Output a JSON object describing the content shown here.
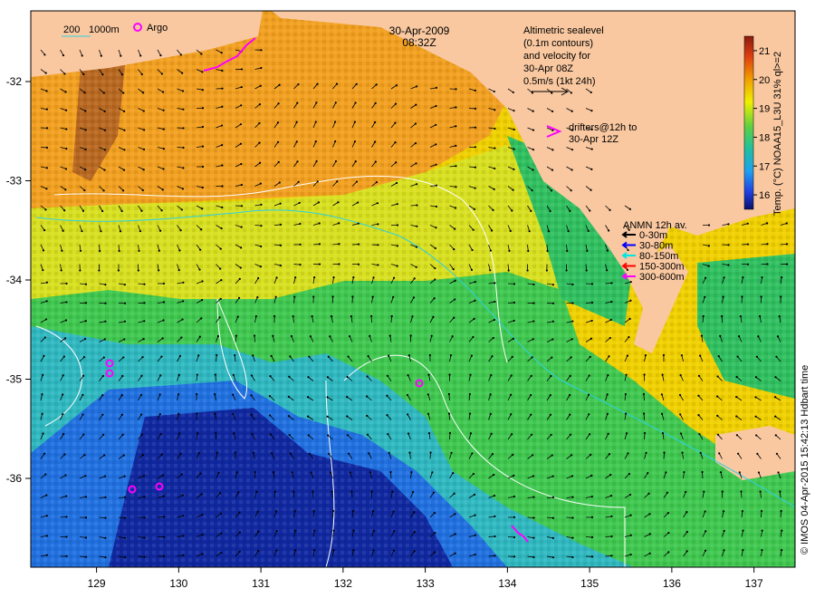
{
  "header": {
    "date": "30-Apr-2009",
    "time": "08:32Z"
  },
  "scale": {
    "label_200": "200",
    "label_1000": "1000m",
    "argo_label": "Argo"
  },
  "altimetry_note": {
    "line1": "Altimetric sealevel",
    "line2": "(0.1m contours)",
    "line3": "and velocity for",
    "line4": "30-Apr 08Z",
    "line5": "0.5m/s (1kt 24h)"
  },
  "drifters_note": {
    "line1": "drifters@12h to",
    "line2": "30-Apr 12Z"
  },
  "anmn_legend": {
    "title": "ANMN 12h av.",
    "items": [
      {
        "label": "0-30m",
        "color": "#000000"
      },
      {
        "label": "30-80m",
        "color": "#0000ff"
      },
      {
        "label": "80-150m",
        "color": "#00e5e5"
      },
      {
        "label": "150-300m",
        "color": "#ff0000"
      },
      {
        "label": "300-600m",
        "color": "#ff00ff"
      }
    ]
  },
  "colorbar": {
    "ticks": [
      "16",
      "17",
      "18",
      "19",
      "20",
      "21"
    ],
    "range": [
      15.5,
      21.5
    ],
    "caption": "Temp. (°C) NOAA15_L3U 31% ql>=2"
  },
  "credit": "© IMOS 04-Apr-2015 15:42:13 Hdbart time",
  "axes": {
    "x_ticks": [
      "129",
      "130",
      "131",
      "132",
      "133",
      "134",
      "135",
      "136",
      "137"
    ],
    "y_ticks": [
      "-32",
      "-33",
      "-34",
      "-35",
      "-36"
    ]
  },
  "colors": {
    "land": "#f9c8a0",
    "drifter": "#ff00ff",
    "contour": "#ffffff",
    "isobath": "#30d0e0"
  }
}
